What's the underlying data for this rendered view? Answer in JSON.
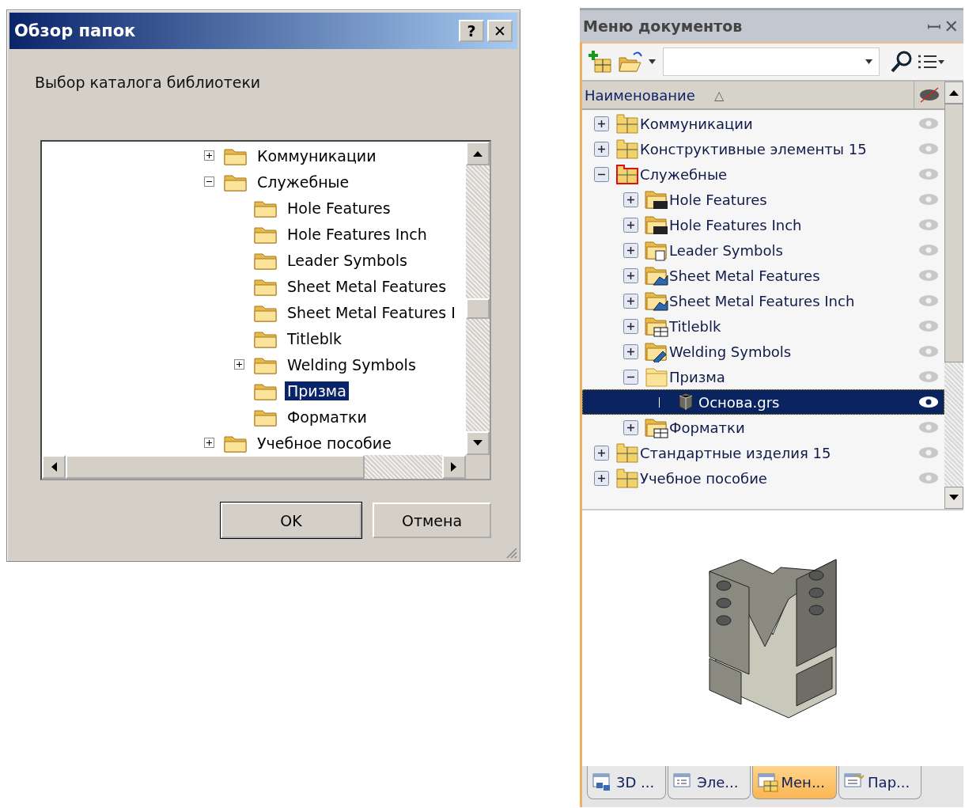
{
  "dialog": {
    "title": "Обзор папок",
    "title_buttons": [
      "?",
      "✕"
    ],
    "prompt": "Выбор каталога библиотеки",
    "tree": [
      {
        "label": "Коммуникации",
        "expanded": false,
        "selected": false
      },
      {
        "label": "Служебные",
        "expanded": true,
        "selected": false,
        "children": [
          {
            "label": "Hole Features",
            "selected": false
          },
          {
            "label": "Hole Features Inch",
            "selected": false
          },
          {
            "label": "Leader Symbols",
            "selected": false
          },
          {
            "label": "Sheet Metal Features",
            "selected": false
          },
          {
            "label": "Sheet Metal Features I",
            "selected": false
          },
          {
            "label": "Titleblk",
            "selected": false
          },
          {
            "label": "Welding Symbols",
            "expanded": false,
            "selected": false
          },
          {
            "label": "Призма",
            "selected": true
          },
          {
            "label": "Форматки",
            "selected": false
          }
        ]
      },
      {
        "label": "Учебное пособие",
        "expanded": false,
        "selected": false
      }
    ],
    "buttons": [
      "OK",
      "Отмена"
    ]
  },
  "panel": {
    "title": "Меню документов",
    "title_buttons": [
      "ꟷ",
      "✕"
    ],
    "column_header": "Наименование",
    "sort_mark": "△",
    "tree": [
      {
        "label": "Коммуникации",
        "kind": "library",
        "expanded": false,
        "selected": false
      },
      {
        "label": "Конструктивные элементы 15",
        "kind": "library",
        "expanded": false,
        "selected": false
      },
      {
        "label": "Служебные",
        "kind": "marked",
        "expanded": true,
        "selected": false,
        "children": [
          {
            "label": "Hole Features",
            "kind": "dims",
            "expanded": false,
            "selected": false
          },
          {
            "label": "Hole Features Inch",
            "kind": "dims",
            "expanded": false,
            "selected": false
          },
          {
            "label": "Leader Symbols",
            "kind": "leader",
            "expanded": false,
            "selected": false
          },
          {
            "label": "Sheet Metal Features",
            "kind": "sheet",
            "expanded": false,
            "selected": false
          },
          {
            "label": "Sheet Metal Features Inch",
            "kind": "sheet",
            "expanded": false,
            "selected": false
          },
          {
            "label": "Titleblk",
            "kind": "table",
            "expanded": false,
            "selected": false
          },
          {
            "label": "Welding Symbols",
            "kind": "weld",
            "expanded": false,
            "selected": false
          },
          {
            "label": "Призма",
            "kind": "folder",
            "expanded": true,
            "selected": false,
            "children": [
              {
                "label": "Основа.grs",
                "kind": "part",
                "selected": true
              }
            ]
          },
          {
            "label": "Форматки",
            "kind": "table",
            "expanded": false,
            "selected": false
          }
        ]
      },
      {
        "label": "Стандартные изделия 15",
        "kind": "library",
        "expanded": false,
        "selected": false
      },
      {
        "label": "Учебное пособие",
        "kind": "library",
        "expanded": false,
        "selected": false
      }
    ],
    "tabs": [
      {
        "label": "3D ...",
        "kind": "assembly",
        "selected": false
      },
      {
        "label": "Эле...",
        "kind": "list",
        "selected": false
      },
      {
        "label": "Мен...",
        "kind": "library",
        "selected": true
      },
      {
        "label": "Пар...",
        "kind": "params",
        "selected": false
      }
    ]
  }
}
